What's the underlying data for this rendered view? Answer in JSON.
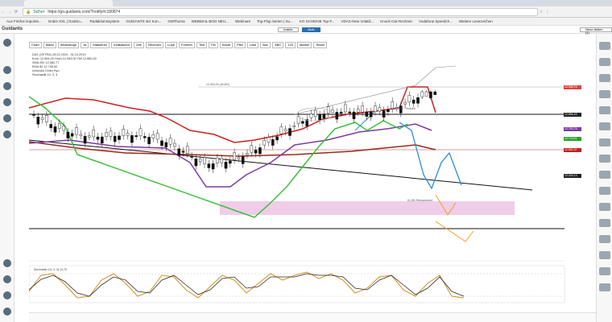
{
  "browser": {
    "url": "https://go.guidants.com/?notify#c180874",
    "security": "Sicher",
    "bookmarks": [
      "Aus Firefox importie...",
      "Gratis XXL | Godmo...",
      "Redaktionssystem",
      "GUIDANTS 3er Kon...",
      "GMThoma",
      "WEBMAIL BOO NEU...",
      "Webinare",
      "Top-Flop Serien | Su...",
      "KO SCHEINE Top-F...",
      "VDAX-New Volatili...",
      "Knock-Out-Rechner",
      "Vodafone Speedch...",
      "Weitere Lesezeichen"
    ]
  },
  "app": {
    "logo": "Guidants",
    "toggle_left": "Inaktiv",
    "toggle_right": "Aktiv",
    "right_button": "Neue Aktien (1)"
  },
  "toolbar": [
    "Chart",
    "Markt",
    "Werkzeuge",
    "1d",
    "Markieren",
    "Indikatoren",
    "Zeit",
    "Zeichnen",
    "Lupe",
    "Formen",
    "Text",
    "Fib",
    "Kanal",
    "Pfeil",
    "Linie",
    "Box",
    "ABC",
    "123",
    "Marker",
    "Reset"
  ],
  "legend": [
    "DAX (XETRA) 28.02.2019 - 31.10.2019",
    "Kurs: 12.894,00  Hoch 12.953,00  Tief 12.880,00",
    "SMA 200 12.582,77",
    "EMA 50 12.745,52",
    "Ichimoku Kinko Hyo",
    "Stochastik 14, 3, 3"
  ],
  "price_tags": [
    {
      "label": "12.988,78",
      "color": "#e04040"
    },
    {
      "label": "12.856,43",
      "color": "#222222"
    },
    {
      "label": "12.782,78",
      "color": "#7d3aa0"
    },
    {
      "label": "12.724,01",
      "color": "#2aa030"
    },
    {
      "label": "12.652,37",
      "color": "#c02020"
    },
    {
      "label": "12.434,13",
      "color": "#222222"
    }
  ],
  "annotations": [
    "Sell Zone / Verkauf",
    "61,8% Retracement",
    "12.090,00 (45,8%)"
  ],
  "stoch_label": "Stochastik (14, 3, 3) 13,75"
}
